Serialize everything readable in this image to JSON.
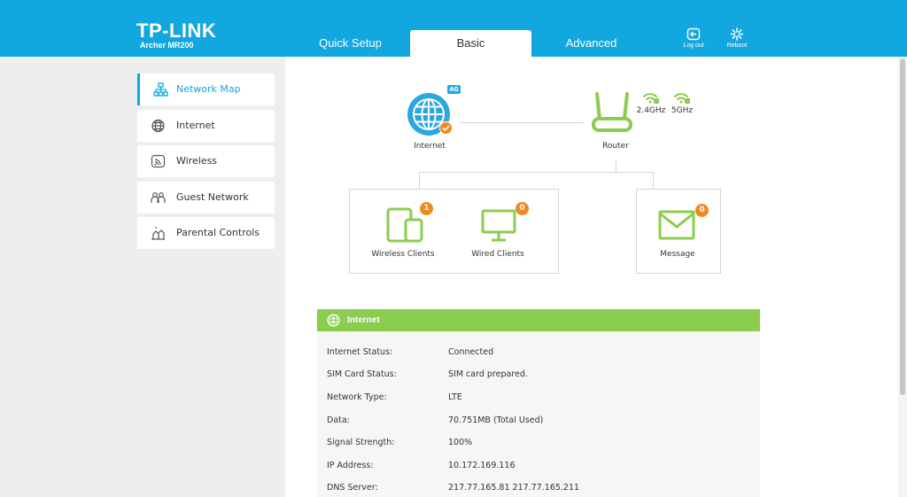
{
  "header": {
    "brand": "TP-LINK",
    "model": "Archer MR200",
    "tabs": [
      "Quick Setup",
      "Basic",
      "Advanced"
    ],
    "active_tab": "Basic",
    "logout_label": "Log out",
    "reboot_label": "Reboot"
  },
  "sidebar": {
    "items": [
      {
        "label": "Network Map",
        "icon": "network-map-icon",
        "active": true
      },
      {
        "label": "Internet",
        "icon": "globe-icon"
      },
      {
        "label": "Wireless",
        "icon": "wireless-icon"
      },
      {
        "label": "Guest Network",
        "icon": "guest-network-icon"
      },
      {
        "label": "Parental Controls",
        "icon": "parental-controls-icon"
      }
    ]
  },
  "network_map": {
    "internet_label": "Internet",
    "internet_badge": "4G",
    "router_label": "Router",
    "band_24": "2.4GHz",
    "band_5": "5GHz",
    "wireless_clients_label": "Wireless Clients",
    "wireless_clients_count": "1",
    "wired_clients_label": "Wired Clients",
    "wired_clients_count": "0",
    "message_label": "Message",
    "message_count": "0"
  },
  "internet_panel": {
    "title": "Internet",
    "rows": [
      {
        "key": "Internet Status:",
        "value": "Connected"
      },
      {
        "key": "SIM Card Status:",
        "value": "SIM card prepared."
      },
      {
        "key": "Network Type:",
        "value": "LTE"
      },
      {
        "key": "Data:",
        "value": "70.751MB (Total Used)"
      },
      {
        "key": "Signal Strength:",
        "value": "100%"
      },
      {
        "key": "IP Address:",
        "value": "10.172.169.116"
      },
      {
        "key": "DNS Server:",
        "value": "217.77.165.81 217.77.165.211"
      }
    ]
  },
  "colors": {
    "brand_blue": "#12a7df",
    "green": "#8ccc4e",
    "orange": "#f0891e"
  }
}
